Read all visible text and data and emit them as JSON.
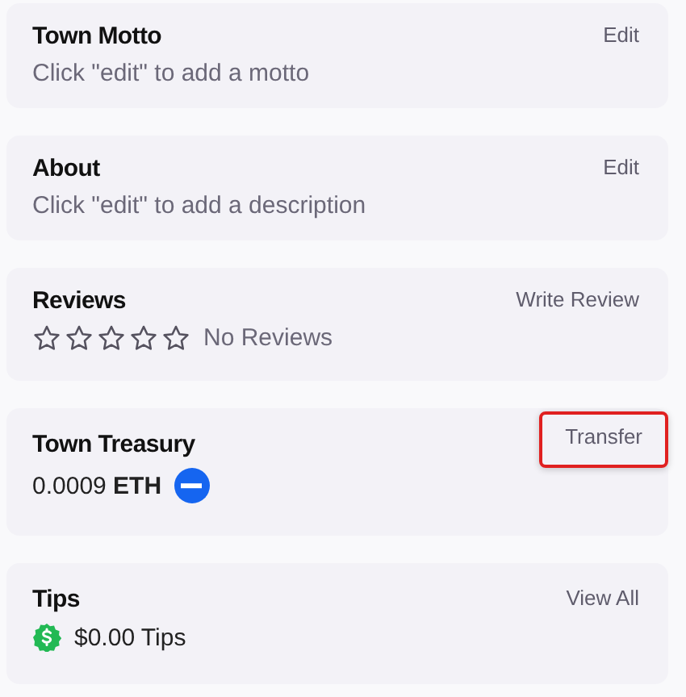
{
  "cards": [
    {
      "kind": "text",
      "title": "Town Motto",
      "action": {
        "label": "Edit",
        "highlighted": false
      },
      "text": "Click \"edit\" to add a motto"
    },
    {
      "kind": "text",
      "title": "About",
      "action": {
        "label": "Edit",
        "highlighted": false
      },
      "text": "Click \"edit\" to add a description"
    },
    {
      "kind": "reviews",
      "title": "Reviews",
      "action": {
        "label": "Write Review",
        "highlighted": false
      },
      "stars": 0,
      "text": "No Reviews"
    },
    {
      "kind": "balance",
      "title": "Town Treasury",
      "action": {
        "label": "Transfer",
        "highlighted": true
      },
      "amount": "0.0009",
      "unit": "ETH"
    },
    {
      "kind": "tips",
      "title": "Tips",
      "action": {
        "label": "View All",
        "highlighted": false
      },
      "text": "$0.00 Tips"
    }
  ]
}
